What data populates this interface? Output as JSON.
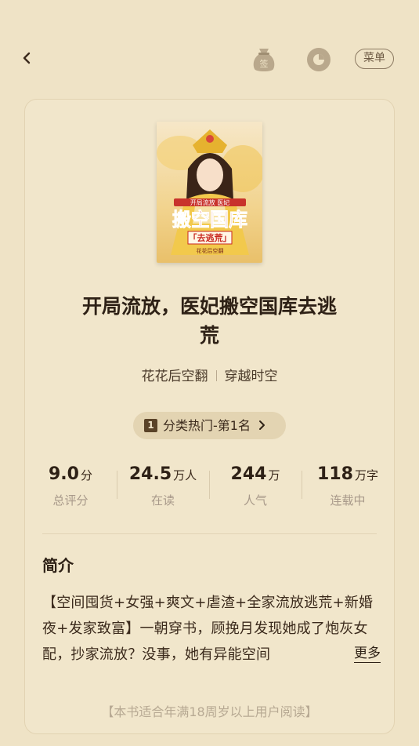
{
  "header": {
    "menu_label": "菜单",
    "bag_icon_char": "签"
  },
  "book": {
    "title_line1": "开局流放，医妃搬空国库去逃",
    "title_line2": "荒",
    "author": "花花后空翻",
    "category": "穿越时空",
    "cover": {
      "tag": "开局流放 医妃",
      "big": "搬空国库",
      "sub": "「去逃荒」",
      "author": "花花后空翻"
    }
  },
  "rank": {
    "badge": "1",
    "label": "分类热门-第1名"
  },
  "stats": [
    {
      "value": "9.0",
      "unit": "分",
      "label": "总评分"
    },
    {
      "value": "24.5",
      "unit": "万人",
      "label": "在读"
    },
    {
      "value": "244",
      "unit": "万",
      "label": "人气"
    },
    {
      "value": "118",
      "unit": "万字",
      "label": "连载中"
    }
  ],
  "intro": {
    "heading": "简介",
    "text": "【空间囤货+女强+爽文+虐渣+全家流放逃荒+新婚夜+发家致富】一朝穿书，顾挽月发现她成了炮灰女配，抄家流放？没事，她有异能空间",
    "more": "更多"
  },
  "notice": "【本书适合年满18周岁以上用户阅读】",
  "colors": {
    "background": "#efe3c6",
    "card": "#f1e6cb",
    "text": "#2e2116",
    "muted": "#a8998a"
  }
}
